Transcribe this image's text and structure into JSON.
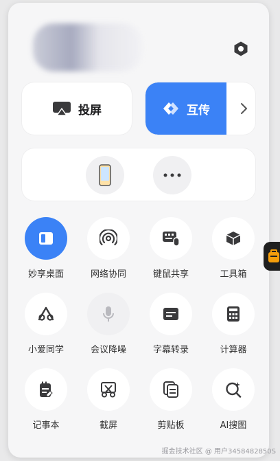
{
  "header": {
    "settings_icon": "gear-hexagon-icon"
  },
  "quick_cards": {
    "screen_cast_label": "投屏",
    "transfer_label": "互传"
  },
  "devices": {
    "more_icon": "more-dots-icon",
    "phone_icon": "phone-icon"
  },
  "grid": [
    {
      "label": "妙享桌面",
      "icon": "window-icon",
      "active": true
    },
    {
      "label": "网络协同",
      "icon": "signal-icon",
      "active": false
    },
    {
      "label": "键鼠共享",
      "icon": "keyboard-mouse-icon",
      "active": false
    },
    {
      "label": "工具箱",
      "icon": "box-icon",
      "active": false
    },
    {
      "label": "小爱同学",
      "icon": "xiaoai-icon",
      "active": false
    },
    {
      "label": "会议降噪",
      "icon": "microphone-icon",
      "disabled": true
    },
    {
      "label": "字幕转录",
      "icon": "subtitle-icon",
      "active": false
    },
    {
      "label": "计算器",
      "icon": "calculator-icon",
      "active": false
    },
    {
      "label": "记事本",
      "icon": "notepad-icon",
      "active": false
    },
    {
      "label": "截屏",
      "icon": "scissors-icon",
      "active": false
    },
    {
      "label": "剪贴板",
      "icon": "clipboard-icon",
      "active": false
    },
    {
      "label": "AI搜图",
      "icon": "ai-search-icon",
      "active": false
    }
  ],
  "watermark": "掘金技术社区 @ 用户3458482850S",
  "colors": {
    "accent": "#3b82f6",
    "panel": "#f6f6f7"
  }
}
